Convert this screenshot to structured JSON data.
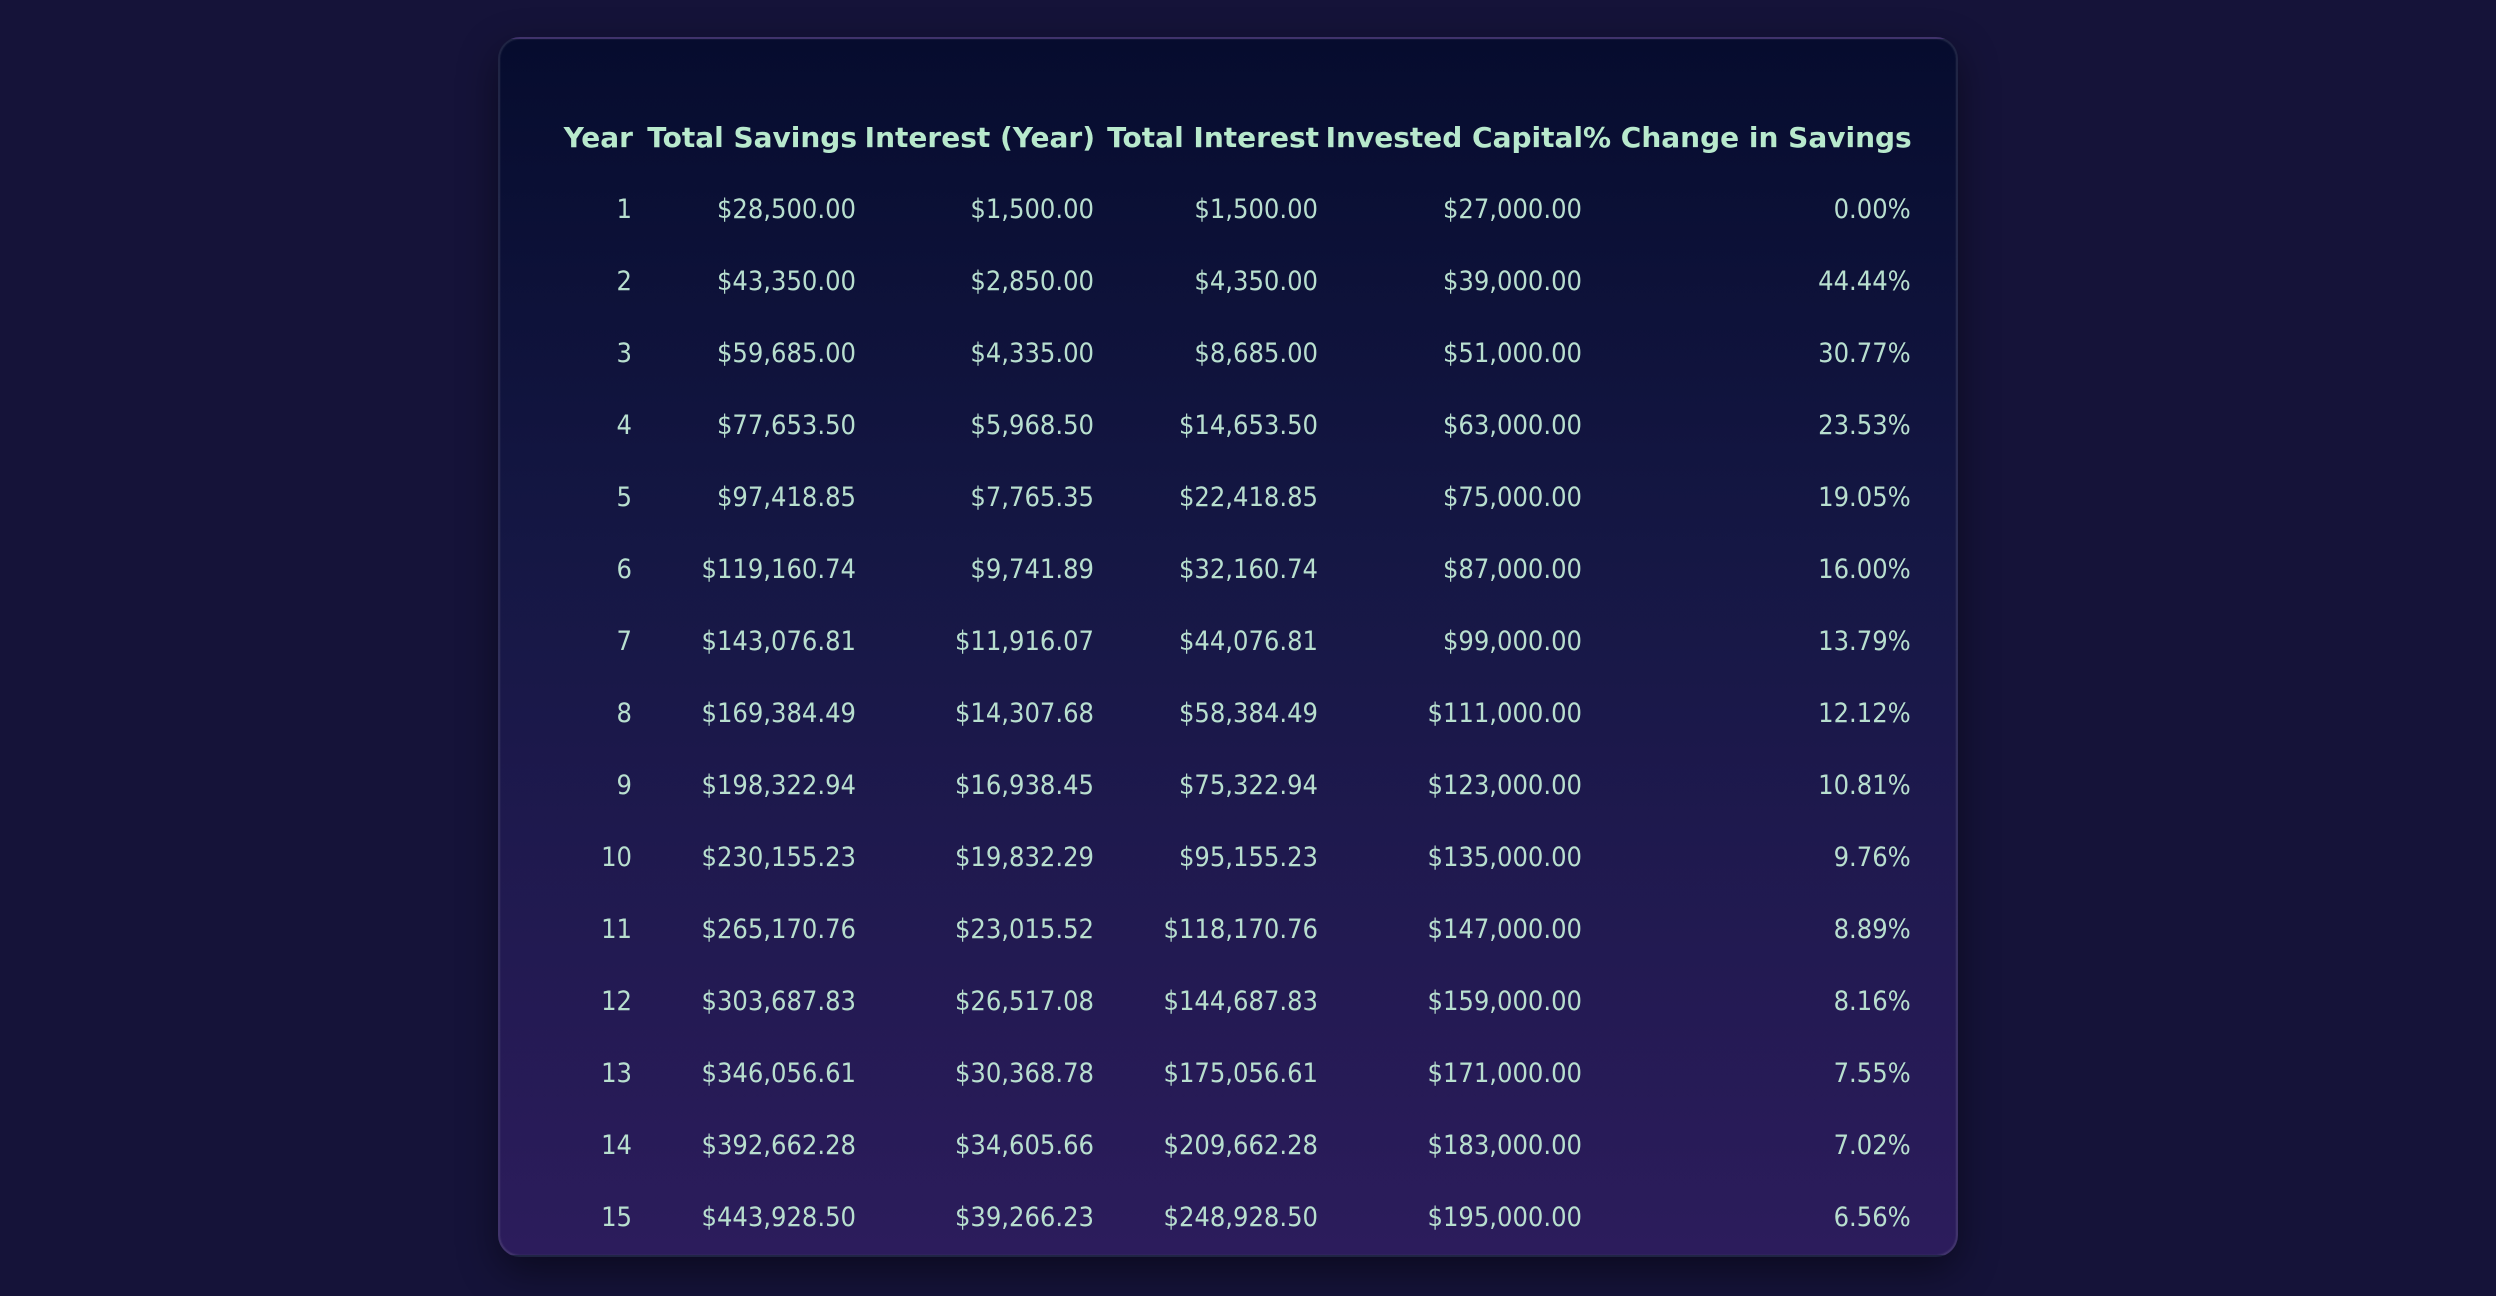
{
  "table": {
    "headers": [
      "Year",
      "Total Savings",
      "Interest (Year)",
      "Total Interest",
      "Invested Capital",
      "% Change in Savings"
    ],
    "rows": [
      [
        "1",
        "$28,500.00",
        "$1,500.00",
        "$1,500.00",
        "$27,000.00",
        "0.00%"
      ],
      [
        "2",
        "$43,350.00",
        "$2,850.00",
        "$4,350.00",
        "$39,000.00",
        "44.44%"
      ],
      [
        "3",
        "$59,685.00",
        "$4,335.00",
        "$8,685.00",
        "$51,000.00",
        "30.77%"
      ],
      [
        "4",
        "$77,653.50",
        "$5,968.50",
        "$14,653.50",
        "$63,000.00",
        "23.53%"
      ],
      [
        "5",
        "$97,418.85",
        "$7,765.35",
        "$22,418.85",
        "$75,000.00",
        "19.05%"
      ],
      [
        "6",
        "$119,160.74",
        "$9,741.89",
        "$32,160.74",
        "$87,000.00",
        "16.00%"
      ],
      [
        "7",
        "$143,076.81",
        "$11,916.07",
        "$44,076.81",
        "$99,000.00",
        "13.79%"
      ],
      [
        "8",
        "$169,384.49",
        "$14,307.68",
        "$58,384.49",
        "$111,000.00",
        "12.12%"
      ],
      [
        "9",
        "$198,322.94",
        "$16,938.45",
        "$75,322.94",
        "$123,000.00",
        "10.81%"
      ],
      [
        "10",
        "$230,155.23",
        "$19,832.29",
        "$95,155.23",
        "$135,000.00",
        "9.76%"
      ],
      [
        "11",
        "$265,170.76",
        "$23,015.52",
        "$118,170.76",
        "$147,000.00",
        "8.89%"
      ],
      [
        "12",
        "$303,687.83",
        "$26,517.08",
        "$144,687.83",
        "$159,000.00",
        "8.16%"
      ],
      [
        "13",
        "$346,056.61",
        "$30,368.78",
        "$175,056.61",
        "$171,000.00",
        "7.55%"
      ],
      [
        "14",
        "$392,662.28",
        "$34,605.66",
        "$209,662.28",
        "$183,000.00",
        "7.02%"
      ],
      [
        "15",
        "$443,928.50",
        "$39,266.23",
        "$248,928.50",
        "$195,000.00",
        "6.56%"
      ]
    ]
  },
  "colors": {
    "page_background": "#151339",
    "panel_top": "#060c2e",
    "panel_bottom": "#2c1c5c",
    "header_text": "#b8e9cd",
    "cell_text": "#b8dfcf"
  }
}
